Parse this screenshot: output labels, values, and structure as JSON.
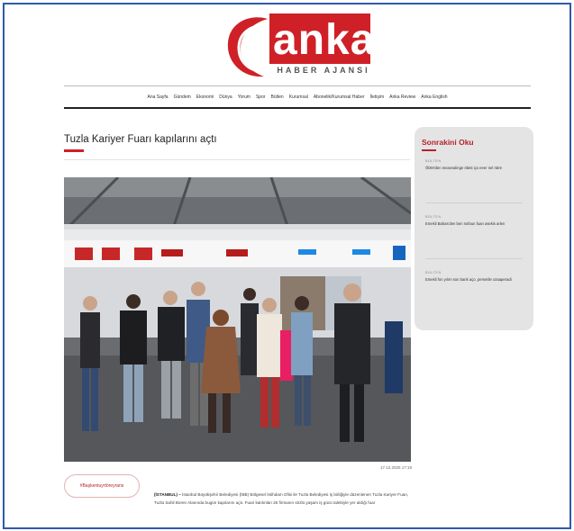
{
  "logo": {
    "word": "anka",
    "tagline": "HABER AJANSI"
  },
  "nav": {
    "items": [
      "Ana Sayfa",
      "Gündem",
      "Ekonomi",
      "Dünya",
      "Yorum",
      "Spor",
      "Bülten",
      "Kurumsal",
      "Abonelik/Kurumsal Haber",
      "İletişim",
      "Anka Review",
      "Anka English"
    ]
  },
  "article": {
    "title": "Tuzla Kariyer Fuarı kapılarını açtı",
    "photo_date": "17.12.2025 17:19",
    "tag": "#Başkentuyrtöreyrans",
    "lead_label": "(İSTANBUL) –",
    "body": "İstanbul Büyükşehir Belediyesi (İBB) Bölgesel İstihdam Ofisi ile Tuzla Belediyesi iş birliğiyle düzenlenen Tuzla Kariyer Fuarı, Tuzla Sahil Boren Alanında bugün kapılarını açtı. Fuari katılınlan 26 firmanın sözlü yaşam iş gücü talebiyle yer aldığı fuar"
  },
  "sidebar": {
    "title": "Sonrakini Oku",
    "items": [
      {
        "category": "BÜLTEN",
        "headline": "ÖDM'den meavvalinge öbeti iço eeer nel rütre"
      },
      {
        "category": "BÜLTEN",
        "headline": "Emekli Bahas'den ben nofoun fuan asekis arlen"
      },
      {
        "category": "BÜLTEN",
        "headline": "Emekli fon yılım son bank aço, persetile ozaaperadi"
      }
    ]
  },
  "colors": {
    "brand_red": "#cf2027",
    "frame_blue": "#2f5aa8",
    "sidebar_bg": "#e4e4e4"
  }
}
